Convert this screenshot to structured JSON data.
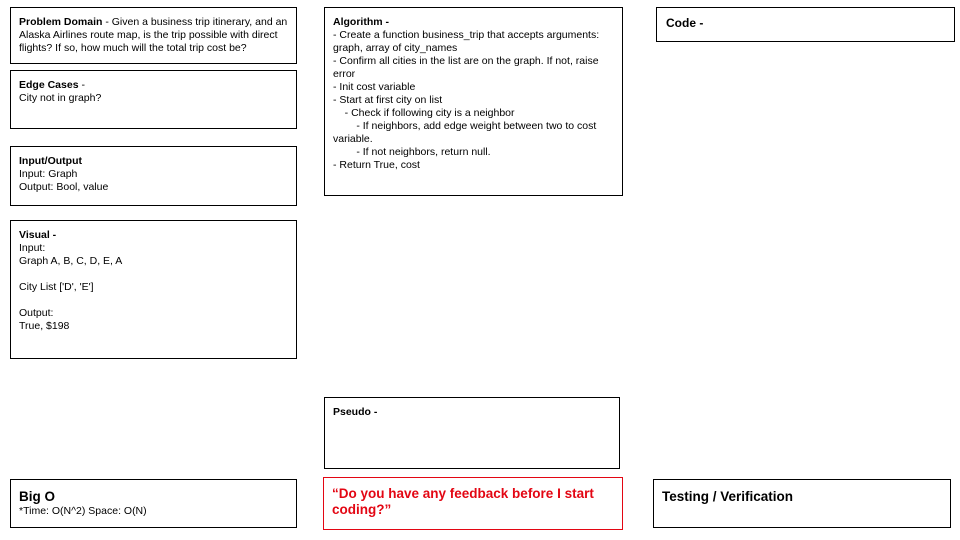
{
  "problem_domain": {
    "title": "Problem Domain",
    "text": " - Given a business trip itinerary, and an Alaska Airlines route map, is the trip possible with direct flights? If so, how much will the total trip cost be?"
  },
  "edge_cases": {
    "title": "Edge Cases",
    "suffix": " -",
    "lines": [
      "City not in graph?"
    ]
  },
  "input_output": {
    "title": "Input/Output",
    "lines": [
      "Input: Graph",
      "Output: Bool, value"
    ]
  },
  "visual": {
    "title": "Visual -",
    "lines": [
      "Input:",
      "Graph A, B, C, D, E, A",
      "",
      "City List ['D', 'E']",
      "",
      "Output:",
      "True, $198"
    ]
  },
  "algorithm": {
    "title": "Algorithm -",
    "lines": [
      "- Create a function business_trip that accepts arguments: graph, array of city_names",
      "- Confirm all cities in the list are on the graph. If not, raise error",
      "- Init cost variable",
      "- Start at first city on list",
      "    - Check if following city is a neighbor",
      "        - If neighbors, add edge weight between two to cost variable.",
      "        - If not neighbors, return null.",
      "- Return True, cost"
    ]
  },
  "code": {
    "title": "Code -"
  },
  "pseudo": {
    "title": "Pseudo -"
  },
  "big_o": {
    "title": "Big O",
    "text": "*Time: O(N^2) Space: O(N)"
  },
  "feedback": {
    "text": "“Do you have any feedback before I start coding?”",
    "color": "#e30613"
  },
  "testing": {
    "title": "Testing / Verification"
  }
}
